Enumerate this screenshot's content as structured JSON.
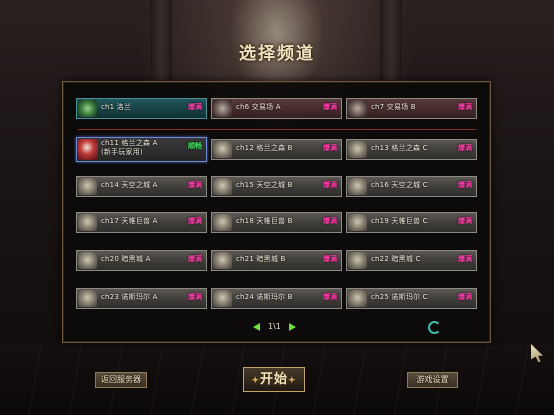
{
  "title": "选择频道",
  "top_channels": [
    {
      "name": "ch1 洛兰",
      "status": "爆满",
      "style": "teal"
    },
    {
      "name": "ch6 交易场 A",
      "status": "爆满",
      "style": "red"
    },
    {
      "name": "ch7 交易场 B",
      "status": "爆满",
      "style": "red"
    }
  ],
  "channels": [
    {
      "name": "ch11 格兰之森 A",
      "sub": "(新手玩家用)",
      "status": "顺畅",
      "style": "sel"
    },
    {
      "name": "ch12 格兰之森 B",
      "status": "爆满"
    },
    {
      "name": "ch13 格兰之森 C",
      "status": "爆满"
    },
    {
      "name": "ch14 天空之城 A",
      "status": "爆满"
    },
    {
      "name": "ch15 天空之城 B",
      "status": "爆满"
    },
    {
      "name": "ch16 天空之城 C",
      "status": "爆满"
    },
    {
      "name": "ch17 天帷巨兽 A",
      "status": "爆满"
    },
    {
      "name": "ch18 天帷巨兽 B",
      "status": "爆满"
    },
    {
      "name": "ch19 天帷巨兽 C",
      "status": "爆满"
    },
    {
      "name": "ch20 暗黑城 A",
      "status": "爆满"
    },
    {
      "name": "ch21 暗黑城 B",
      "status": "爆满"
    },
    {
      "name": "ch22 暗黑城 C",
      "status": "爆满"
    },
    {
      "name": "ch23 诺斯玛尔 A",
      "status": "爆满"
    },
    {
      "name": "ch24 诺斯玛尔 B",
      "status": "爆满"
    },
    {
      "name": "ch25 诺斯玛尔 C",
      "status": "爆满"
    }
  ],
  "pager": {
    "text": "1\\1"
  },
  "buttons": {
    "left": "返回服务器",
    "start": "开始",
    "right": "游戏设置"
  }
}
